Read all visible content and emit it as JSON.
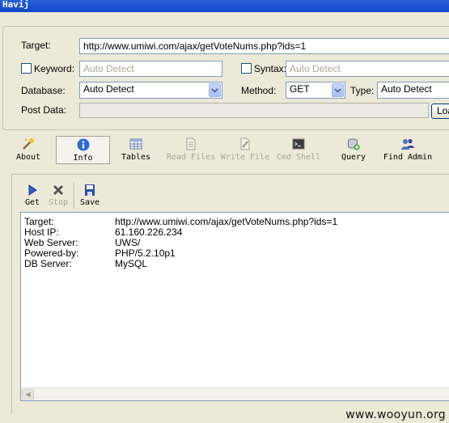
{
  "window": {
    "title": "Havij"
  },
  "form": {
    "target_label": "Target:",
    "target_value": "http://www.umiwi.com/ajax/getVoteNums.php?ids=1",
    "keyword_label": "Keyword:",
    "keyword_placeholder": "Auto Detect",
    "syntax_label": "Syntax:",
    "syntax_placeholder": "Auto Detect",
    "database_label": "Database:",
    "database_value": "Auto Detect",
    "method_label": "Method:",
    "method_value": "GET",
    "type_label": "Type:",
    "type_value": "Auto Detect",
    "postdata_label": "Post Data:",
    "postdata_value": "",
    "load_button": "Loa"
  },
  "toolbar": {
    "items": [
      {
        "label": "About",
        "icon": "wand-icon"
      },
      {
        "label": "Info",
        "icon": "info-icon",
        "selected": true
      },
      {
        "label": "Tables",
        "icon": "table-icon"
      },
      {
        "label": "Read Files",
        "icon": "file-icon",
        "disabled": true
      },
      {
        "label": "Write File",
        "icon": "pen-icon",
        "disabled": true
      },
      {
        "label": "Cmd Shell",
        "icon": "terminal-icon",
        "disabled": true
      },
      {
        "label": "Query",
        "icon": "query-icon"
      },
      {
        "label": "Find Admin",
        "icon": "users-icon"
      }
    ]
  },
  "info_toolbar": {
    "get_label": "Get",
    "stop_label": "Stop",
    "save_label": "Save"
  },
  "output": {
    "rows": [
      {
        "key": "Target:",
        "value": "http://www.umiwi.com/ajax/getVoteNums.php?ids=1"
      },
      {
        "key": "Host IP:",
        "value": "61.160.226.234"
      },
      {
        "key": "Web Server:",
        "value": "UWS/"
      },
      {
        "key": "Powered-by:",
        "value": "PHP/5.2.10p1"
      },
      {
        "key": "DB Server:",
        "value": "MySQL"
      }
    ]
  },
  "watermark": "www.wooyun.org",
  "colors": {
    "titlebar": "#1046c8",
    "panel_bg": "#ece9d8",
    "info_icon": "#2a6ad8"
  }
}
